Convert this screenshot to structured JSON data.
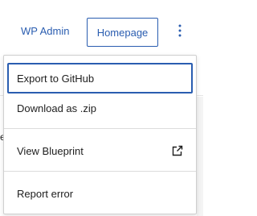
{
  "toolbar": {
    "wp_admin_label": "WP Admin",
    "homepage_label": "Homepage",
    "more_icon": "vertical-ellipsis-icon"
  },
  "background": {
    "edge_char": "e"
  },
  "menu": {
    "items": [
      {
        "label": "Export to GitHub",
        "focused": true
      },
      {
        "label": "Download as .zip"
      },
      {
        "label": "View Blueprint",
        "icon": "external-link-icon"
      },
      {
        "label": "Report error"
      }
    ]
  },
  "colors": {
    "accent": "#2a5db0",
    "text": "#1e1e1e",
    "border": "#cfcfcf"
  }
}
